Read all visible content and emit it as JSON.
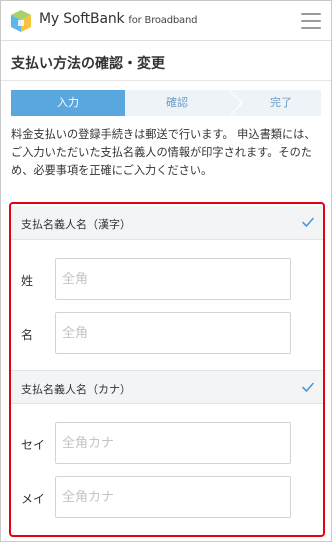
{
  "header": {
    "logo_main": "My SoftBank",
    "logo_sub": "for Broadband",
    "menu_icon": "hamburger-menu-icon",
    "logo_icon": "softbank-cube-logo-icon"
  },
  "page": {
    "title": "支払い方法の確認・変更"
  },
  "steps": [
    {
      "label": "入力",
      "active": true
    },
    {
      "label": "確認",
      "active": false
    },
    {
      "label": "完了",
      "active": false
    }
  ],
  "intro": "料金支払いの登録手続きは郵送で行います。 申込書類には、ご入力いただいた支払名義人の情報が印字されます。そのため、必要事項を正確にご入力ください。",
  "form": {
    "kanji": {
      "heading": "支払名義人名（漢字）",
      "check_icon": "checkmark-icon",
      "last_name": {
        "label": "姓",
        "placeholder": "全角",
        "value": ""
      },
      "first_name": {
        "label": "名",
        "placeholder": "全角",
        "value": ""
      }
    },
    "kana": {
      "heading": "支払名義人名（カナ）",
      "check_icon": "checkmark-icon",
      "last_name": {
        "label": "セイ",
        "placeholder": "全角カナ",
        "value": ""
      },
      "first_name": {
        "label": "メイ",
        "placeholder": "全角カナ",
        "value": ""
      }
    }
  },
  "colors": {
    "accent": "#5aa7e0",
    "highlight_border": "#e60012",
    "step_inactive_bg": "#eef3f8",
    "section_bg": "#f3f4f6"
  }
}
